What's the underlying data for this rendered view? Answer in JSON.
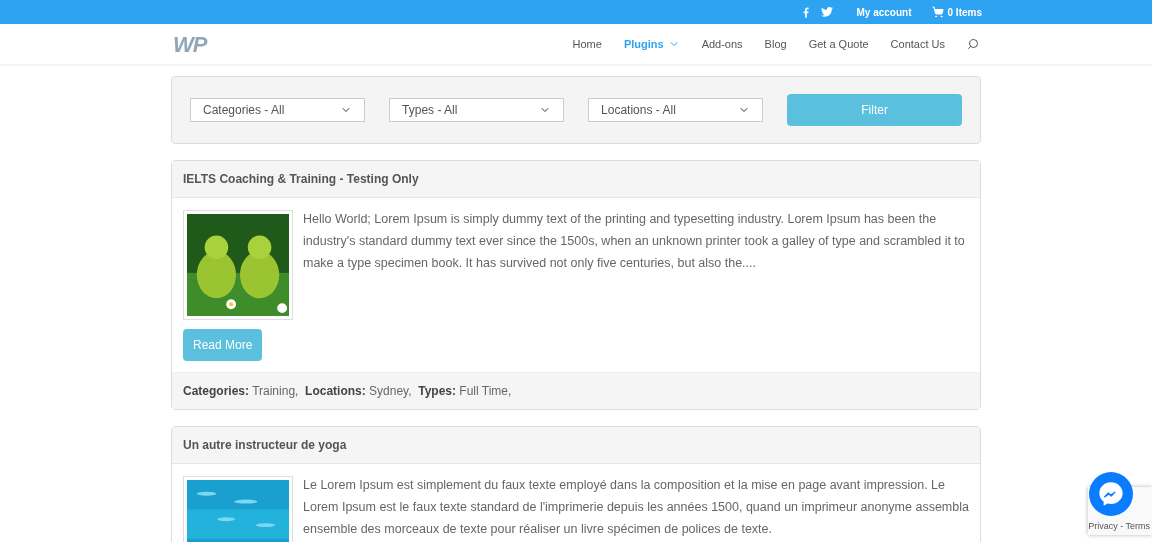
{
  "top_bar": {
    "account": "My account",
    "cart": "0 Items"
  },
  "header": {
    "logo": "WP",
    "nav": [
      {
        "label": "Home",
        "selected": false,
        "dropdown": false
      },
      {
        "label": "Plugins",
        "selected": true,
        "dropdown": true
      },
      {
        "label": "Add-ons",
        "selected": false,
        "dropdown": false
      },
      {
        "label": "Blog",
        "selected": false,
        "dropdown": false
      },
      {
        "label": "Get a Quote",
        "selected": false,
        "dropdown": false
      },
      {
        "label": "Contact Us",
        "selected": false,
        "dropdown": false
      }
    ]
  },
  "filters": {
    "selects": [
      "Categories - All",
      "Types - All",
      "Locations - All"
    ],
    "button": "Filter"
  },
  "listings": [
    {
      "title": "IELTS Coaching & Training - Testing Only",
      "kind": "picture",
      "description": "Hello World; Lorem Ipsum is simply dummy text of the printing and typesetting industry. Lorem Ipsum has been the industry's standard dummy text ever since the 1500s, when an unknown printer took a galley of type and scrambled it to make a type specimen book. It has survived not only five centuries, but also the....",
      "button": "Read More",
      "meta": "**Categories:** Training,  **Locations:** Sydney,  **Types:** Full Time,"
    },
    {
      "title": "Un autre instructeur de yoga",
      "kind": "picture",
      "description": "Le Lorem Ipsum est simplement du faux texte employé dans la composition et la mise en page avant impression. Le Lorem Ipsum est le faux texte standard de l'imprimerie depuis les années 1500, quand un imprimeur anonyme assembla ensemble des morceaux de texte pour réaliser un livre spécimen de polices de texte."
    }
  ],
  "recaptcha": {
    "links": "Privacy - Terms"
  }
}
